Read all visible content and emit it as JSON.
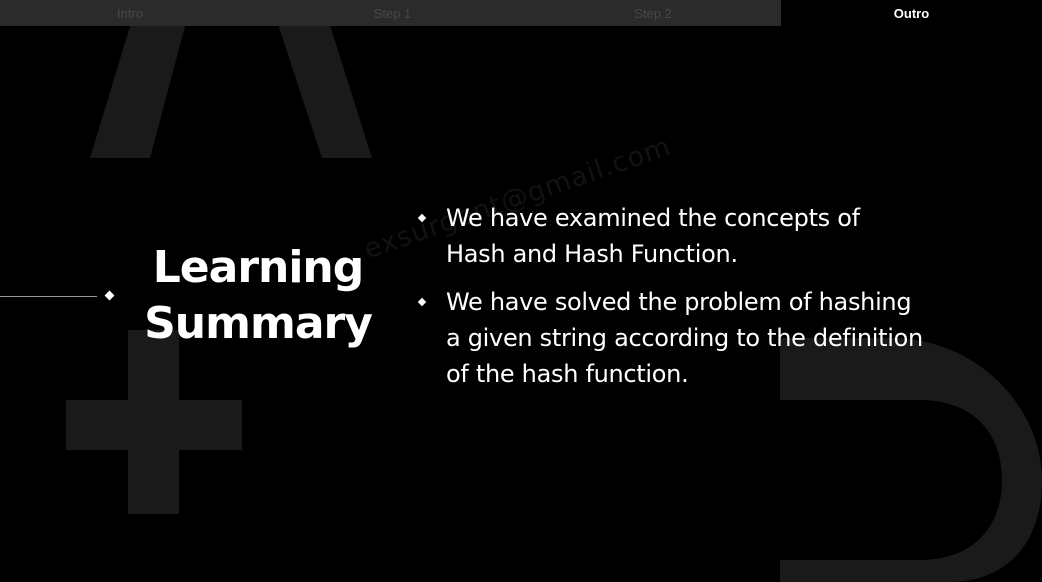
{
  "tabs": [
    {
      "label": "Intro",
      "active": false
    },
    {
      "label": "Step 1",
      "active": false
    },
    {
      "label": "Step 2",
      "active": false
    },
    {
      "label": "Outro",
      "active": true
    }
  ],
  "slide": {
    "title_line1": "Learning",
    "title_line2": "Summary",
    "bullets": [
      {
        "line1": "We have examined the concepts of",
        "line2": "Hash and Hash Function."
      },
      {
        "line1": "We have solved the problem of hashing",
        "line2": "a given string according to the definition",
        "line3": "of the hash function."
      }
    ],
    "watermark": "exsurgent@gmail.com"
  },
  "colors": {
    "background": "#000000",
    "tab_inactive_bg": "#2b2b2b",
    "tab_inactive_text": "#474747",
    "text": "#ffffff",
    "decor": "#1a1a1a"
  },
  "icons": {
    "bullet": "diamond-icon",
    "connector": "diamond-icon"
  }
}
